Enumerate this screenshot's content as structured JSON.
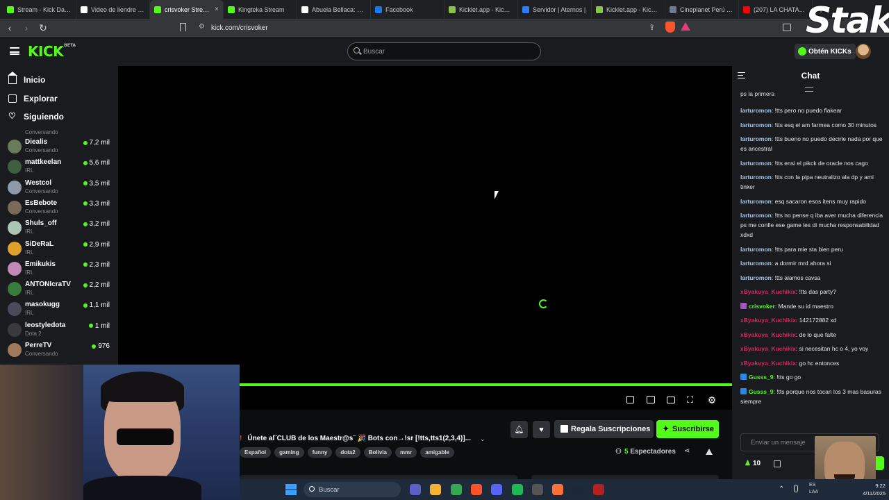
{
  "browser": {
    "tabs": [
      {
        "label": "Stream - Kick Dashboard",
        "icon": "kick-icon",
        "color": "#53fc18"
      },
      {
        "label": "Video de liendre m...",
        "icon": "tiktok-icon",
        "color": "#ffffff"
      },
      {
        "label": "crisvoker Stream",
        "icon": "kick-icon",
        "color": "#53fc18",
        "active": true
      },
      {
        "label": "Kingteka Stream",
        "icon": "kick-icon",
        "color": "#53fc18"
      },
      {
        "label": "Abuela Bellaca: El H...",
        "icon": "tiktok-icon",
        "color": "#ffffff"
      },
      {
        "label": "Facebook",
        "icon": "meta-icon",
        "color": "#1877f2"
      },
      {
        "label": "Kicklet.app - Kick Ch...",
        "icon": "kicklet-icon",
        "color": "#8bc34a"
      },
      {
        "label": "Servidor | Aternos |",
        "icon": "aternos-icon",
        "color": "#2e7dff"
      },
      {
        "label": "Kicklet.app - Kick Ch...",
        "icon": "kicklet-icon",
        "color": "#8bc34a"
      },
      {
        "label": "Cineplanet Perú | Lo...",
        "icon": "globe-icon",
        "color": "#6e7a90"
      },
      {
        "label": "(207) LA CHATA...",
        "icon": "youtube-icon",
        "color": "#ff0000"
      }
    ],
    "url": "kick.com/crisvoker"
  },
  "overlay": {
    "stake_logo": "Stake"
  },
  "header": {
    "logo": "KICK",
    "logo_tag": "BETA",
    "search_placeholder": "Buscar",
    "get_kicks": "Obtén KICKs"
  },
  "sidebar": {
    "nav": [
      {
        "label": "Inicio",
        "icon": "home-icon"
      },
      {
        "label": "Explorar",
        "icon": "explore-icon"
      },
      {
        "label": "Siguiendo",
        "icon": "heart-icon"
      }
    ],
    "partial_label": "Conversando",
    "channels": [
      {
        "name": "Diealis",
        "category": "Conversando",
        "viewers": "7,2 mil",
        "color": "#6a7b5c"
      },
      {
        "name": "mattkeelan",
        "category": "IRL",
        "viewers": "5,6 mil",
        "color": "#3f5e3f"
      },
      {
        "name": "Westcol",
        "category": "Conversando",
        "viewers": "3,5 mil",
        "color": "#8f9aa8"
      },
      {
        "name": "EsBebote",
        "category": "Conversando",
        "viewers": "3,3 mil",
        "color": "#7b6a5a"
      },
      {
        "name": "Shuls_off",
        "category": "IRL",
        "viewers": "3,2 mil",
        "color": "#a9c7b4"
      },
      {
        "name": "SiDeRaL",
        "category": "IRL",
        "viewers": "2,9 mil",
        "color": "#e0a12a"
      },
      {
        "name": "Emikukis",
        "category": "IRL",
        "viewers": "2,3 mil",
        "color": "#c28ab5"
      },
      {
        "name": "ANTONIcraTV",
        "category": "IRL",
        "viewers": "2,2 mil",
        "color": "#3a7a3a"
      },
      {
        "name": "masokugg",
        "category": "IRL",
        "viewers": "1,1 mil",
        "color": "#4a4a5a"
      },
      {
        "name": "leostyledota",
        "category": "Dota 2",
        "viewers": "1 mil",
        "color": "#3a3a3a"
      },
      {
        "name": "PerreTV",
        "category": "Conversando",
        "viewers": "976",
        "color": "#a07a5a"
      }
    ]
  },
  "stream": {
    "title_marker": "!",
    "title": "Únete al¨CLUB de los Maestr@s¨ 🎉 Bots con→!sr [!tts,tts1(2,3,4)]...",
    "tags": [
      "Español",
      "gaming",
      "funny",
      "dota2",
      "Bolivia",
      "mmr",
      "amigable"
    ],
    "gift_label": "Regala Suscripciones",
    "subscribe_label": "Suscribirse",
    "viewers_count": "5",
    "viewers_label": "Espectadores",
    "progress": 1.0,
    "accent": "#53fc18"
  },
  "chat": {
    "title": "Chat",
    "partial": "ps la primera",
    "messages": [
      {
        "user": "larturomon",
        "color": "#a9c6e8",
        "text": "!tts pero no puedo flakear"
      },
      {
        "user": "larturomon",
        "color": "#a9c6e8",
        "text": "!tts esq el am farmea como 30 minutos"
      },
      {
        "user": "larturomon",
        "color": "#a9c6e8",
        "text": "!tts bueno no puedo decirle nada por que es ancestral"
      },
      {
        "user": "larturomon",
        "color": "#a9c6e8",
        "text": "!tts ensi el pikck de oracle nos cago"
      },
      {
        "user": "larturomon",
        "color": "#a9c6e8",
        "text": "!tts con la pipa neutralizo ala dp y ami tinker"
      },
      {
        "user": "larturomon",
        "color": "#a9c6e8",
        "text": "esq sacaron esos itens muy rapido"
      },
      {
        "user": "larturomon",
        "color": "#a9c6e8",
        "text": "!tts no pense q iba aver mucha diferencia ps me confie ese game les di mucha responsabilidad xdxd"
      },
      {
        "user": "larturomon",
        "color": "#a9c6e8",
        "text": "!tts para mie sta bien peru"
      },
      {
        "user": "larturomon",
        "color": "#a9c6e8",
        "text": "a dormir mrd ahora si"
      },
      {
        "user": "larturomon",
        "color": "#a9c6e8",
        "text": "!tts alamos cavsa"
      },
      {
        "user": "xByakuya_Kuchikix",
        "color": "#e0245e",
        "text": "!tts das party?"
      },
      {
        "user": "crisvoker",
        "color": "#53fc18",
        "text": "Mande su id maestro",
        "badge": "#9b59b6"
      },
      {
        "user": "xByakuya_Kuchikix",
        "color": "#e0245e",
        "text": "142172882 xd"
      },
      {
        "user": "xByakuya_Kuchikix",
        "color": "#e0245e",
        "text": "de lo que falte"
      },
      {
        "user": "xByakuya_Kuchikix",
        "color": "#e0245e",
        "text": "si necesitan hc o 4, yo voy"
      },
      {
        "user": "xByakuya_Kuchikix",
        "color": "#e0245e",
        "text": "go hc entonces"
      },
      {
        "user": "Gusss_9",
        "color": "#53fc18",
        "text": "!tts go go",
        "badge": "#2e86de"
      },
      {
        "user": "Gusss_9",
        "color": "#53fc18",
        "text": "!tts porque nos tocan los 3 mas basuras siempre",
        "badge": "#2e86de"
      }
    ],
    "input_placeholder": "Enviar un mensaje",
    "kicks": "10"
  },
  "taskbar": {
    "search": "Buscar",
    "lang": "ES\nLAA",
    "time": "9:22",
    "date": "4/11/2025",
    "apps": [
      {
        "name": "teams-icon",
        "color": "#5b5fc7"
      },
      {
        "name": "folder-icon",
        "color": "#f2b233"
      },
      {
        "name": "chrome-icon",
        "color": "#34a853"
      },
      {
        "name": "brave-icon",
        "color": "#fb542b"
      },
      {
        "name": "discord-icon",
        "color": "#5865f2"
      },
      {
        "name": "spotify-icon",
        "color": "#1db954"
      },
      {
        "name": "obs-icon",
        "color": "#555"
      },
      {
        "name": "firefox-icon",
        "color": "#ff7139"
      },
      {
        "name": "steam-icon",
        "color": "#1b2838"
      },
      {
        "name": "dota-icon",
        "color": "#b22222"
      }
    ]
  }
}
